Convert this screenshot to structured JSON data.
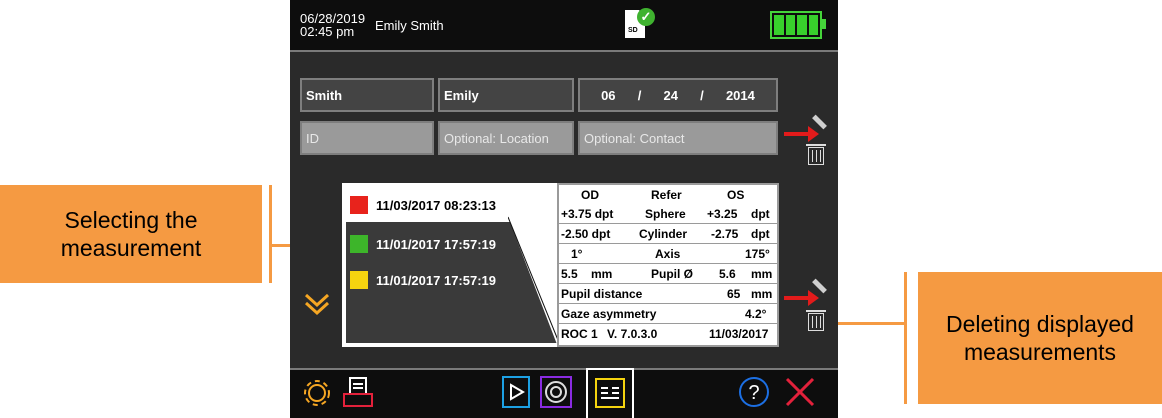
{
  "callouts": {
    "left": "Selecting the measurement",
    "right": "Deleting displayed measurements"
  },
  "status_bar": {
    "date": "06/28/2019",
    "time": "02:45 pm",
    "user": "Emily Smith",
    "sd_label": "SD",
    "battery_level": 1.0
  },
  "patient": {
    "last_name": "Smith",
    "first_name": "Emily",
    "dob_month": "06",
    "dob_day": "24",
    "dob_year": "2014",
    "dob_sep": "/",
    "id_placeholder": "ID",
    "location_placeholder": "Optional: Location",
    "contact_placeholder": "Optional: Contact"
  },
  "measurements": [
    {
      "timestamp": "11/03/2017 08:23:13",
      "color": "#e8231c"
    },
    {
      "timestamp": "11/01/2017 17:57:19",
      "color": "#3db52a"
    },
    {
      "timestamp": "11/01/2017 17:57:19",
      "color": "#f5d40f"
    }
  ],
  "table": {
    "head_od": "OD",
    "head_refer": "Refer",
    "head_os": "OS",
    "sphere_od": "+3.75 dpt",
    "sphere_label": "Sphere",
    "sphere_os": "+3.25",
    "sphere_unit": "dpt",
    "cyl_od": "-2.50 dpt",
    "cyl_label": "Cylinder",
    "cyl_os": "-2.75",
    "cyl_unit": "dpt",
    "axis_od": "1°",
    "axis_label": "Axis",
    "axis_os": "175°",
    "pupil_od": "5.5",
    "pupil_od_unit": "mm",
    "pupil_label": "Pupil Ø",
    "pupil_os": "5.6",
    "pupil_os_unit": "mm",
    "pd_label": "Pupil distance",
    "pd_value": "65",
    "pd_unit": "mm",
    "gaze_label": "Gaze asymmetry",
    "gaze_value": "4.2°",
    "roc": "ROC 1",
    "version": "V. 7.0.3.0",
    "date": "11/03/2017"
  },
  "icons": {
    "settings": "gear-icon",
    "print": "printer-icon",
    "video": "video-icon",
    "target": "target-icon",
    "report": "report-icon",
    "help": "help-icon",
    "close": "close-icon"
  },
  "colors": {
    "callout": "#f59a42",
    "delete_arrow": "#e31b1b",
    "battery": "#38d02c",
    "highlight": "#f5a623"
  }
}
